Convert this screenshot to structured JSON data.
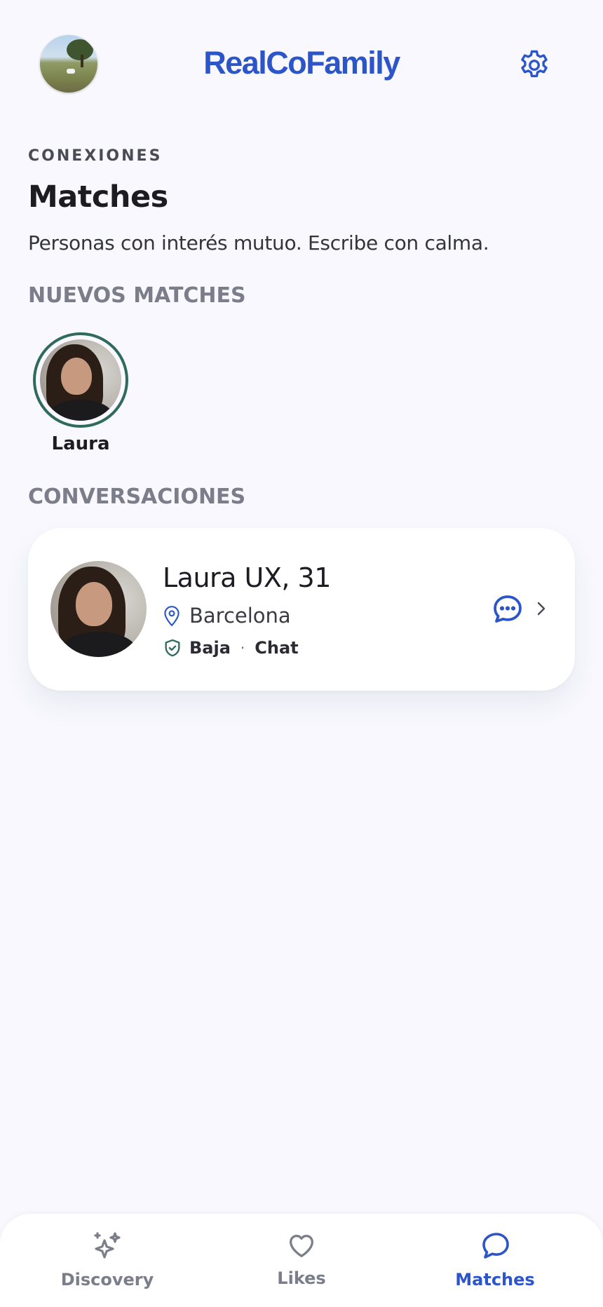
{
  "header": {
    "app_title": "RealCoFamily",
    "avatar_icon": "user-avatar",
    "settings_icon": "gear-icon"
  },
  "content": {
    "eyebrow": "CONEXIONES",
    "title": "Matches",
    "subtitle": "Personas con interés mutuo. Escribe con calma.",
    "new_matches_label": "NUEVOS MATCHES",
    "new_matches": [
      {
        "name": "Laura"
      }
    ],
    "conversations_label": "CONVERSACIONES",
    "conversations": [
      {
        "name_age": "Laura UX, 31",
        "location": "Barcelona",
        "meta_primary": "Baja",
        "meta_separator": "·",
        "meta_secondary": "Chat"
      }
    ]
  },
  "nav": {
    "items": [
      {
        "label": "Discovery",
        "icon": "sparkles-icon",
        "active": false
      },
      {
        "label": "Likes",
        "icon": "heart-icon",
        "active": false
      },
      {
        "label": "Matches",
        "icon": "chat-bubble-icon",
        "active": true
      }
    ]
  },
  "colors": {
    "brand": "#2b55c9",
    "ring": "#2f6a5c",
    "background": "#f8f8fe",
    "muted": "#7b7d8a"
  }
}
